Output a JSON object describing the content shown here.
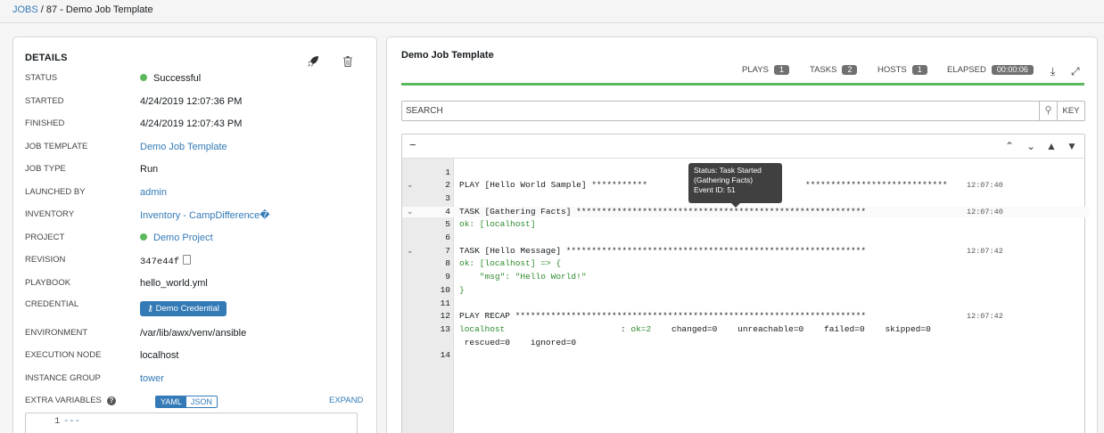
{
  "breadcrumb": {
    "jobs": "JOBS",
    "separator": "/",
    "current": "87 - Demo Job Template"
  },
  "details": {
    "title": "DETAILS",
    "status": {
      "label": "STATUS",
      "value": "Successful",
      "color": "#5cb85c"
    },
    "started": {
      "label": "STARTED",
      "value": "4/24/2019 12:07:36 PM"
    },
    "finished": {
      "label": "FINISHED",
      "value": "4/24/2019 12:07:43 PM"
    },
    "job_template": {
      "label": "JOB TEMPLATE",
      "value": "Demo Job Template"
    },
    "job_type": {
      "label": "JOB TYPE",
      "value": "Run"
    },
    "launched_by": {
      "label": "LAUNCHED BY",
      "value": "admin"
    },
    "inventory": {
      "label": "INVENTORY",
      "value": "Inventory - CampDifference�"
    },
    "project": {
      "label": "PROJECT",
      "value": "Demo Project"
    },
    "revision": {
      "label": "REVISION",
      "value": "347e44f"
    },
    "playbook": {
      "label": "PLAYBOOK",
      "value": "hello_world.yml"
    },
    "credential": {
      "label": "CREDENTIAL",
      "value": "Demo Credential"
    },
    "environment": {
      "label": "ENVIRONMENT",
      "value": "/var/lib/awx/venv/ansible"
    },
    "execution_node": {
      "label": "EXECUTION NODE",
      "value": "localhost"
    },
    "instance_group": {
      "label": "INSTANCE GROUP",
      "value": "tower"
    },
    "extra_vars": {
      "label": "EXTRA VARIABLES",
      "help": "?",
      "yaml": "YAML",
      "json": "JSON",
      "expand": "EXPAND",
      "line_num": "1",
      "content": "---"
    }
  },
  "output": {
    "title": "Demo Job Template",
    "plays_label": "PLAYS",
    "plays": "1",
    "tasks_label": "TASKS",
    "tasks": "2",
    "hosts_label": "HOSTS",
    "hosts": "1",
    "elapsed_label": "ELAPSED",
    "elapsed": "00:00:06",
    "progress": 1.0,
    "search_placeholder": "SEARCH",
    "key_label": "KEY",
    "collapse": "−",
    "tooltip": {
      "line1": "Status: Task Started",
      "line2": "(Gathering Facts)",
      "line3": "Event ID: 51"
    },
    "lines": [
      {
        "n": "1",
        "text": "",
        "ts": "",
        "chev": false,
        "green": false
      },
      {
        "n": "2",
        "text": "PLAY [Hello World Sample] ***********",
        "text2": "****************************",
        "ts": "12:07:40",
        "chev": true,
        "green": false
      },
      {
        "n": "3",
        "text": "",
        "ts": "",
        "chev": false,
        "green": false
      },
      {
        "n": "4",
        "text": "TASK [Gathering Facts] *********************************************************",
        "ts": "12:07:40",
        "chev": true,
        "green": false
      },
      {
        "n": "5",
        "text": "ok: [localhost]",
        "ts": "",
        "chev": false,
        "green": true
      },
      {
        "n": "6",
        "text": "",
        "ts": "",
        "chev": false,
        "green": false
      },
      {
        "n": "7",
        "text": "TASK [Hello Message] ***********************************************************",
        "ts": "12:07:42",
        "chev": true,
        "green": false
      },
      {
        "n": "8",
        "text": "ok: [localhost] => {",
        "ts": "",
        "chev": false,
        "green": true
      },
      {
        "n": "9",
        "text": "    \"msg\": \"Hello World!\"",
        "ts": "",
        "chev": false,
        "green": true
      },
      {
        "n": "10",
        "text": "}",
        "ts": "",
        "chev": false,
        "green": true
      },
      {
        "n": "11",
        "text": "",
        "ts": "",
        "chev": false,
        "green": false
      },
      {
        "n": "12",
        "text": "PLAY RECAP *********************************************************************",
        "ts": "12:07:42",
        "chev": false,
        "green": false
      },
      {
        "n": "13",
        "text": "localhost",
        "recap": ": ok=2    changed=0    unreachable=0    failed=0    skipped=0",
        "ts": "",
        "chev": false,
        "green": false
      },
      {
        "n": "",
        "text": " rescued=0    ignored=0",
        "ts": "",
        "chev": false,
        "green": false
      },
      {
        "n": "14",
        "text": "",
        "ts": "",
        "chev": false,
        "green": false
      }
    ]
  }
}
